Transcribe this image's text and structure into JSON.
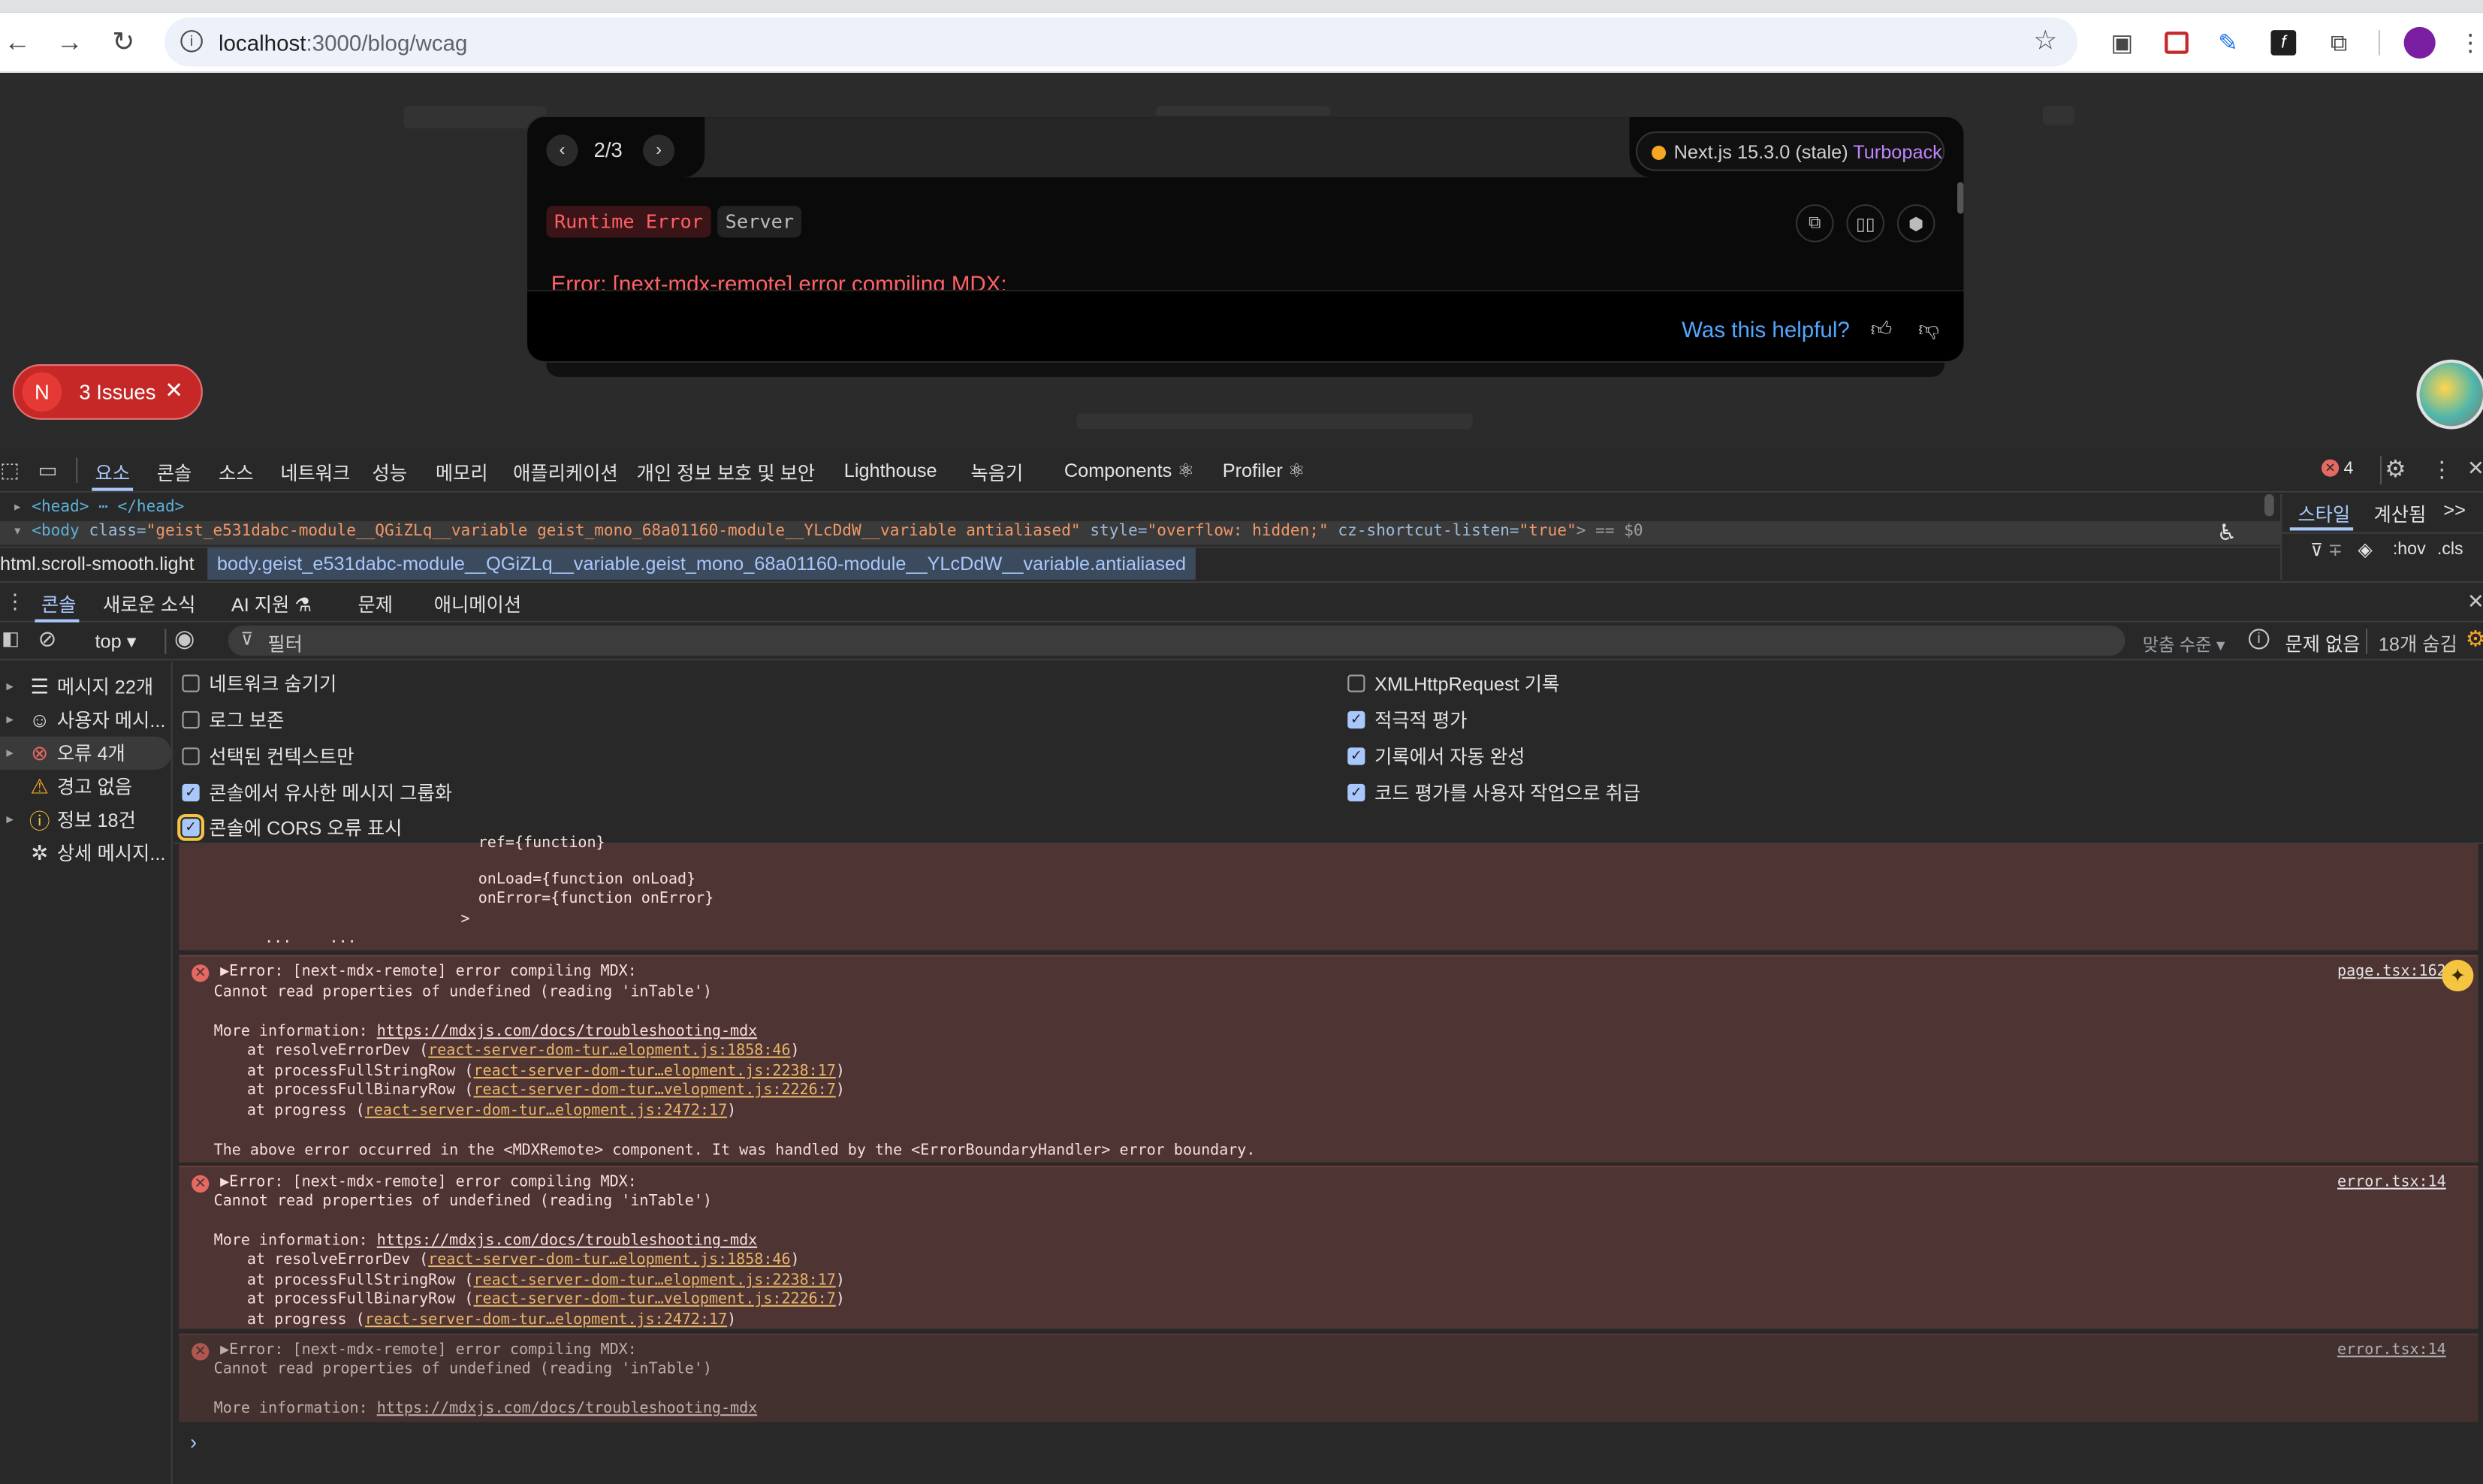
{
  "browser": {
    "url_host": "localhost",
    "url_path": ":3000/blog/wcag",
    "back": "←",
    "forward": "→",
    "reload": "↻",
    "star": "☆"
  },
  "overlay": {
    "page_indicator": "2/3",
    "prev": "‹",
    "next": "›",
    "version": "Next.js 15.3.0 (stale)",
    "bundler": "Turbopack",
    "badge_runtime": "Runtime Error",
    "badge_server": "Server",
    "error_title": "Error: [next-mdx-remote] error compiling MDX:",
    "helpful": "Was this helpful?"
  },
  "issues": {
    "n": "N",
    "label": "3 Issues",
    "close": "✕"
  },
  "devtools": {
    "tabs": [
      "요소",
      "콘솔",
      "소스",
      "네트워크",
      "성능",
      "메모리",
      "애플리케이션",
      "개인 정보 보호 및 보안",
      "Lighthouse",
      "녹음기",
      "Components ⚛",
      "Profiler ⚛"
    ],
    "error_count": "4",
    "head_line": "<head> ⋯ </head>",
    "body_tag": "<body",
    "body_class_attr": "class=",
    "body_class_val": "\"geist_e531dabc-module__QGiZLq__variable geist_mono_68a01160-module__YLcDdW__variable antialiased\"",
    "body_style_attr": "style=",
    "body_style_val": "\"overflow: hidden;\"",
    "body_cz_attr": "cz-shortcut-listen=",
    "body_cz_val": "\"true\"",
    "body_tail": "> == $0",
    "crumb1": "html.scroll-smooth.light",
    "crumb2": "body.geist_e531dabc-module__QGiZLq__variable.geist_mono_68a01160-module__YLcDdW__variable.antialiased",
    "styles_tabs": [
      "스타일",
      "계산됨"
    ],
    "styles_more": ">>",
    "styles_filter": "∓",
    "styles_hov": ":hov",
    "styles_cls": ".cls",
    "drawer_tabs": [
      "콘솔",
      "새로운 소식",
      "AI 지원 ⚗",
      "문제",
      "애니메이션"
    ],
    "context": "top ▾",
    "filter_placeholder": "필터",
    "levels": "맞춤 수준 ▾",
    "no_issues": "문제 없음",
    "hidden_count": "18개 숨김"
  },
  "settings": {
    "left": [
      {
        "label": "네트워크 숨기기",
        "checked": false
      },
      {
        "label": "로그 보존",
        "checked": false
      },
      {
        "label": "선택된 컨텍스트만",
        "checked": false
      },
      {
        "label": "콘솔에서 유사한 메시지 그룹화",
        "checked": true
      },
      {
        "label": "콘솔에 CORS 오류 표시",
        "checked": true
      }
    ],
    "right": [
      {
        "label": "XMLHttpRequest 기록",
        "checked": false
      },
      {
        "label": "적극적 평가",
        "checked": true
      },
      {
        "label": "기록에서 자동 완성",
        "checked": true
      },
      {
        "label": "코드 평가를 사용자 작업으로 취급",
        "checked": true
      }
    ]
  },
  "sidebar": [
    {
      "label": "메시지 22개",
      "icon": "list-icon"
    },
    {
      "label": "사용자 메시...",
      "icon": "user-icon"
    },
    {
      "label": "오류 4개",
      "icon": "error-icon"
    },
    {
      "label": "경고 없음",
      "icon": "warning-icon"
    },
    {
      "label": "정보 18건",
      "icon": "info-icon"
    },
    {
      "label": "상세 메시지...",
      "icon": "bug-icon"
    }
  ],
  "log": {
    "frag1": "ref={function}",
    "frag2": "onLoad={function onLoad}",
    "frag3": "onError={function onError}",
    "frag4": ">",
    "frag5": "...",
    "frag6": "...",
    "err_line1": "▶Error: [next-mdx-remote] error compiling MDX:",
    "err_line2": "Cannot read properties of undefined (reading 'inTable')",
    "more_info": "More information: ",
    "more_link": "https://mdxjs.com/docs/troubleshooting-mdx",
    "at": "at ",
    "open_paren": " (",
    "close_paren": ")",
    "stack": [
      {
        "fn": "resolveErrorDev",
        "src": "react-server-dom-tur…elopment.js:1858:46"
      },
      {
        "fn": "processFullStringRow",
        "src": "react-server-dom-tur…elopment.js:2238:17"
      },
      {
        "fn": "processFullBinaryRow",
        "src": "react-server-dom-tur…velopment.js:2226:7"
      },
      {
        "fn": "progress",
        "src": "react-server-dom-tur…elopment.js:2472:17"
      }
    ],
    "boundary": "The above error occurred in the <MDXRemote> component. It was handled by the <ErrorBoundaryHandler> error boundary.",
    "src1": "page.tsx:162",
    "src2": "error.tsx:14",
    "src3": "error.tsx:14",
    "prompt": "›"
  }
}
